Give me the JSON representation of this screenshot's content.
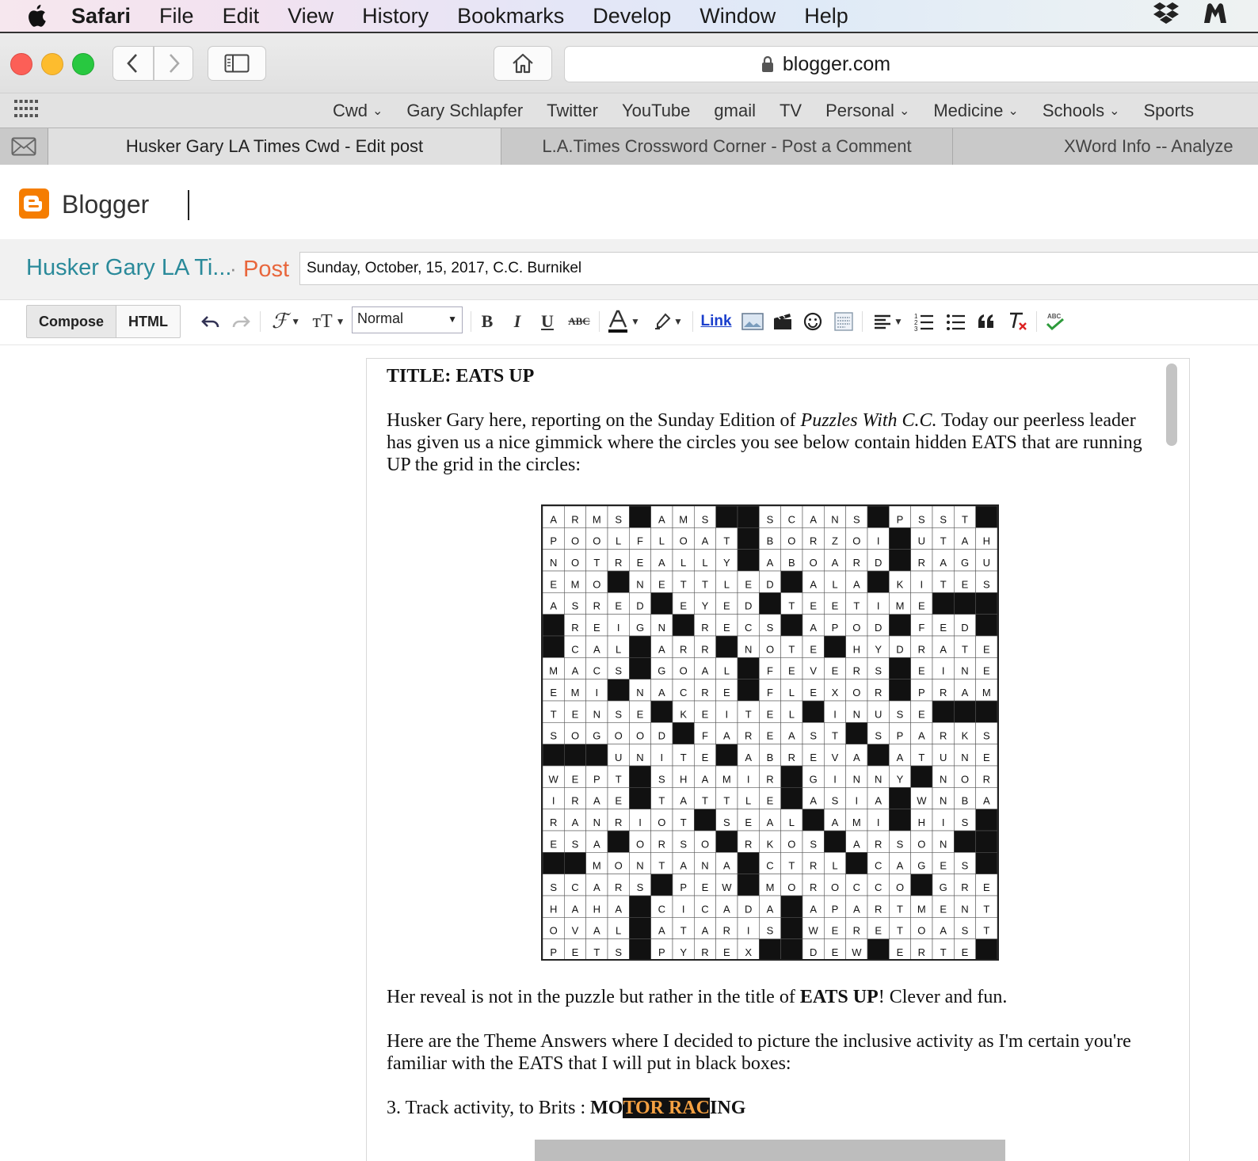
{
  "menubar": {
    "app": "Safari",
    "items": [
      "File",
      "Edit",
      "View",
      "History",
      "Bookmarks",
      "Develop",
      "Window",
      "Help"
    ]
  },
  "toolbar": {
    "url": "blogger.com"
  },
  "bookmarks": [
    {
      "label": "Cwd",
      "menu": true
    },
    {
      "label": "Gary Schlapfer",
      "menu": false
    },
    {
      "label": "Twitter",
      "menu": false
    },
    {
      "label": "YouTube",
      "menu": false
    },
    {
      "label": "gmail",
      "menu": false
    },
    {
      "label": "TV",
      "menu": false
    },
    {
      "label": "Personal",
      "menu": true
    },
    {
      "label": "Medicine",
      "menu": true
    },
    {
      "label": "Schools",
      "menu": true
    },
    {
      "label": "Sports",
      "menu": false
    }
  ],
  "tabs": [
    "Husker Gary LA Times Cwd - Edit post",
    "L.A.Times Crossword Corner - Post a Comment",
    "XWord Info -- Analyze"
  ],
  "blogger": {
    "brand": "Blogger",
    "blog_title": "Husker Gary LA Ti...",
    "separator": "·",
    "post_label": "Post",
    "post_title": "Sunday, October, 15, 2017, C.C. Burnikel"
  },
  "editor_toolbar": {
    "compose": "Compose",
    "html": "HTML",
    "format": "Normal",
    "bold": "B",
    "italic": "I",
    "underline": "U",
    "strike": "ABC",
    "link": "Link"
  },
  "post": {
    "title_line": "TITLE: EATS UP",
    "intro_1": "Husker Gary here, reporting  on the Sunday Edition of ",
    "intro_italic": "Puzzles With C.C.",
    "intro_2": " Today our peerless leader has given us a nice gimmick where the circles you see below contain hidden EATS that are running UP the grid in the circles:",
    "reveal_1": "Her reveal is not in the puzzle but rather in the title of ",
    "reveal_bold": "EATS UP",
    "reveal_2": "! Clever and fun.",
    "theme_text": "Here are the Theme Answers where I decided to picture the inclusive activity as I'm certain you're familiar with the EATS that I will put in black boxes:",
    "clue_3": "3. Track activity, to Brits : ",
    "ans_a": "MO",
    "ans_b": "TOR RAC",
    "ans_c": "ING"
  },
  "crossword": {
    "rows": [
      "ARMS#AMS##SCANS#PSST",
      "POOLFLOAT#BORZOI#UTAH",
      "NOTREALLY#ABOARD#RAGU",
      "EMO#NETTLED#ALA#KITES",
      "ASRED#EYED#TEETIME#",
      "#REIGN#RECS#APOD#FED",
      "#CAL#ARR#NOTE#HYDRATE",
      "MACS#GOAL#FEVERS#EINE",
      "EMI#NACRE#FLEXOR#PRAM",
      "TENSE#KEITEL#INUSE#",
      "SOGOOD#FAREAST#SPARKS",
      "###UNITE#ABREVA#ATUNE",
      "WEPT#SHAMIR#GINNY#NOR",
      "IRAE#TATTLE#ASIA#WNBA",
      "RANRIOT#SEAL#AMI#HIS",
      "ESA#ORSO#RKOS#ARSON#",
      "##MONTANA#CTRL#CAGES",
      "SCARS#PEW#MOROCCO#GRE",
      "HAHA#CICADA#APARTMENT",
      "OVAL#ATARIS#WERETOAST",
      "PETS#PYREX##DEW#ERTE"
    ]
  }
}
